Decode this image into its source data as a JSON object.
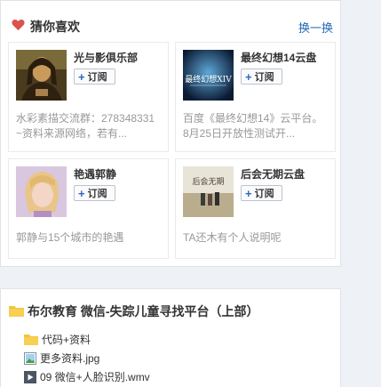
{
  "recommend": {
    "title": "猜你喜欢",
    "refresh_label": "换一换",
    "subscribe_label": "订阅",
    "cards": [
      {
        "name": "光与影俱乐部",
        "desc_line1": "水彩素描交流群：278348331",
        "desc_line2": "~资料来源网络，若有..."
      },
      {
        "name": "最终幻想14云盘",
        "desc_line1": "百度《最终幻想14》云平台。",
        "desc_line2": "8月25日开放性测试开...",
        "thumb_text": "最终幻想XIV"
      },
      {
        "name": "艳遇郭静",
        "desc_line1": "郭静与15个城市的艳遇",
        "desc_line2": ""
      },
      {
        "name": "后会无期云盘",
        "desc_line1": "TA还木有个人说明呢",
        "desc_line2": "",
        "thumb_text": "后会无期"
      }
    ]
  },
  "folder": {
    "title": "布尔教育 微信-失踪儿童寻找平台（上部）",
    "items": [
      {
        "name": "代码+资料",
        "icon": "folder-icon"
      },
      {
        "name": "更多资料.jpg",
        "icon": "image-file-icon"
      },
      {
        "name": "09 微信+人脸识别.wmv",
        "icon": "video-file-icon"
      }
    ]
  },
  "colors": {
    "accent": "#2469b5",
    "heart": "#d9534f",
    "folder": "#f5c33b"
  }
}
